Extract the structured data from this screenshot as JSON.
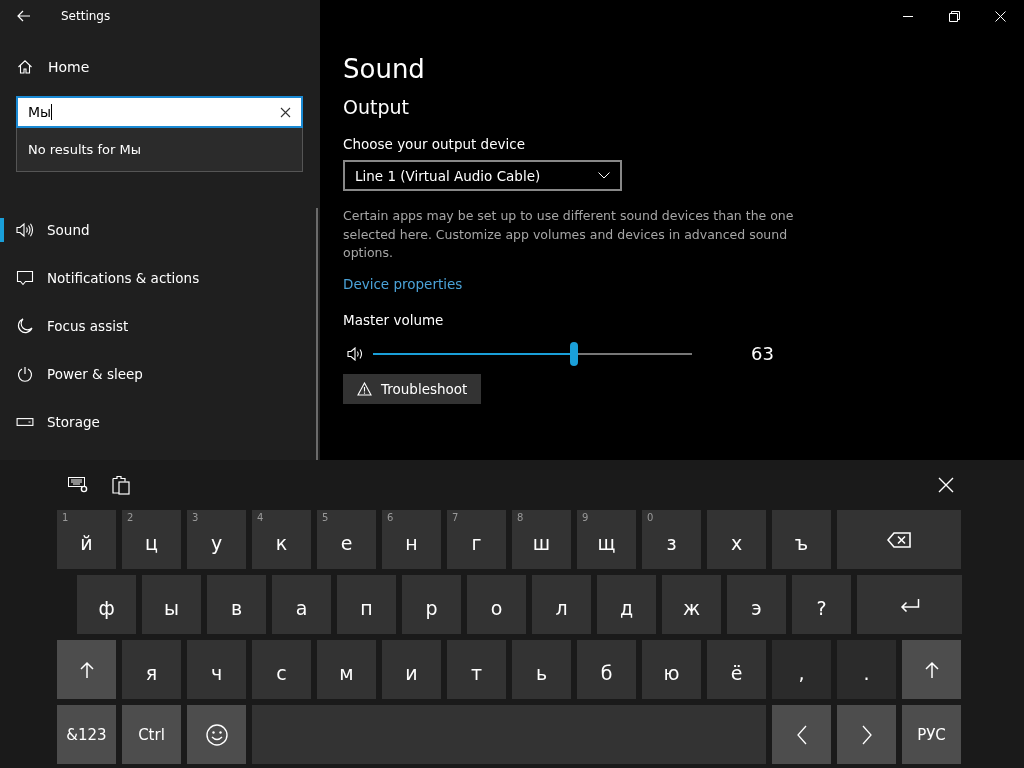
{
  "window": {
    "title": "Settings"
  },
  "sidebar": {
    "home": "Home",
    "search": {
      "value": "Мы"
    },
    "search_result": "No results for Мы",
    "items": [
      {
        "label": "Sound",
        "kind": "speaker",
        "selected": true
      },
      {
        "label": "Notifications & actions",
        "kind": "message",
        "selected": false
      },
      {
        "label": "Focus assist",
        "kind": "moon",
        "selected": false
      },
      {
        "label": "Power & sleep",
        "kind": "power",
        "selected": false
      },
      {
        "label": "Storage",
        "kind": "storage",
        "selected": false
      }
    ]
  },
  "main": {
    "title": "Sound",
    "section": "Output",
    "device_label": "Choose your output device",
    "device_value": "Line 1 (Virtual Audio Cable)",
    "description": "Certain apps may be set up to use different sound devices than the one selected here. Customize app volumes and devices in advanced sound options.",
    "link": "Device properties",
    "volume": {
      "label": "Master volume",
      "level": 0.63,
      "reading": "63"
    },
    "troubleshoot": "Troubleshoot"
  },
  "keyboard": {
    "rows": [
      [
        {
          "kind": "char",
          "label": "й",
          "hint": "1"
        },
        {
          "kind": "char",
          "label": "ц",
          "hint": "2"
        },
        {
          "kind": "char",
          "label": "у",
          "hint": "3"
        },
        {
          "kind": "char",
          "label": "к",
          "hint": "4"
        },
        {
          "kind": "char",
          "label": "е",
          "hint": "5"
        },
        {
          "kind": "char",
          "label": "н",
          "hint": "6"
        },
        {
          "kind": "char",
          "label": "г",
          "hint": "7"
        },
        {
          "kind": "char",
          "label": "ш",
          "hint": "8"
        },
        {
          "kind": "char",
          "label": "щ",
          "hint": "9"
        },
        {
          "kind": "char",
          "label": "з",
          "hint": "0"
        },
        {
          "kind": "char",
          "label": "х"
        },
        {
          "kind": "char",
          "label": "ъ"
        },
        {
          "kind": "backspace"
        }
      ],
      [
        {
          "kind": "char",
          "label": "ф"
        },
        {
          "kind": "char",
          "label": "ы"
        },
        {
          "kind": "char",
          "label": "в"
        },
        {
          "kind": "char",
          "label": "а"
        },
        {
          "kind": "char",
          "label": "п"
        },
        {
          "kind": "char",
          "label": "р"
        },
        {
          "kind": "char",
          "label": "о"
        },
        {
          "kind": "char",
          "label": "л"
        },
        {
          "kind": "char",
          "label": "д"
        },
        {
          "kind": "char",
          "label": "ж"
        },
        {
          "kind": "char",
          "label": "э"
        },
        {
          "kind": "char",
          "label": "?"
        },
        {
          "kind": "enter"
        }
      ],
      [
        {
          "kind": "shift"
        },
        {
          "kind": "char",
          "label": "я"
        },
        {
          "kind": "char",
          "label": "ч"
        },
        {
          "kind": "char",
          "label": "с"
        },
        {
          "kind": "char",
          "label": "м"
        },
        {
          "kind": "char",
          "label": "и"
        },
        {
          "kind": "char",
          "label": "т"
        },
        {
          "kind": "char",
          "label": "ь"
        },
        {
          "kind": "char",
          "label": "б"
        },
        {
          "kind": "char",
          "label": "ю"
        },
        {
          "kind": "char",
          "label": "ё"
        },
        {
          "kind": "punct",
          "label": ","
        },
        {
          "kind": "punct",
          "label": "."
        },
        {
          "kind": "shift"
        }
      ],
      [
        {
          "kind": "function",
          "label": "&123"
        },
        {
          "kind": "function",
          "label": "Ctrl"
        },
        {
          "kind": "emoji"
        },
        {
          "kind": "space"
        },
        {
          "kind": "left"
        },
        {
          "kind": "right"
        },
        {
          "kind": "function",
          "label": "РУС"
        }
      ]
    ]
  }
}
